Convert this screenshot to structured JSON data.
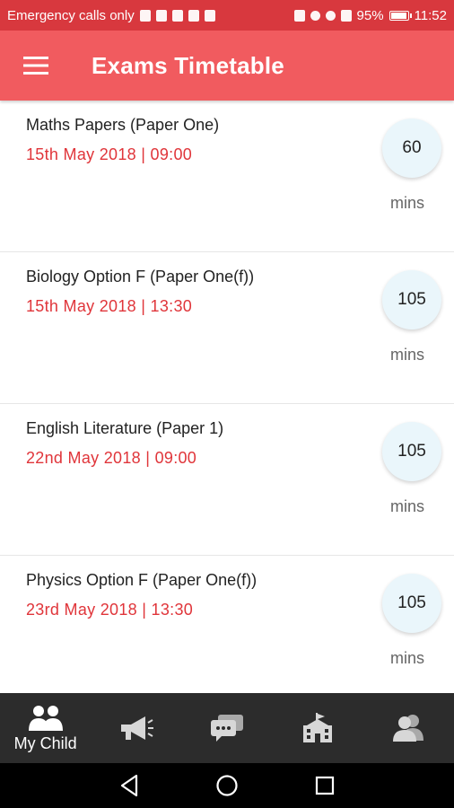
{
  "status_bar": {
    "carrier_text": "Emergency calls only",
    "battery_percent": "95%",
    "time": "11:52"
  },
  "app_bar": {
    "title": "Exams Timetable",
    "menu_icon": "hamburger-menu-icon"
  },
  "exams": [
    {
      "name": "Maths Papers (Paper One)",
      "datetime": "15th May 2018 | 09:00",
      "duration": "60",
      "unit": "mins"
    },
    {
      "name": "Biology Option F (Paper One(f))",
      "datetime": "15th May 2018 | 13:30",
      "duration": "105",
      "unit": "mins"
    },
    {
      "name": "English Literature (Paper 1)",
      "datetime": "22nd May 2018 | 09:00",
      "duration": "105",
      "unit": "mins"
    },
    {
      "name": "Physics Option F (Paper One(f))",
      "datetime": "23rd May 2018 | 13:30",
      "duration": "105",
      "unit": "mins"
    }
  ],
  "bottom_nav": {
    "items": [
      {
        "label": "My Child",
        "icon": "my-child-icon",
        "active": true
      },
      {
        "label": "",
        "icon": "megaphone-icon"
      },
      {
        "label": "",
        "icon": "chat-bubbles-icon"
      },
      {
        "label": "",
        "icon": "school-building-icon"
      },
      {
        "label": "",
        "icon": "contacts-icon"
      }
    ]
  },
  "colors": {
    "status_bar": "#d8383e",
    "app_bar": "#f15b5f",
    "date_text": "#e0353a",
    "bottom_nav": "#2c2c2c"
  }
}
